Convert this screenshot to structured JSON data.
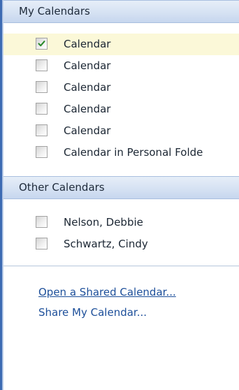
{
  "my_calendars": {
    "header": "My Calendars",
    "items": [
      {
        "label": "Calendar",
        "checked": true
      },
      {
        "label": "Calendar",
        "checked": false
      },
      {
        "label": "Calendar",
        "checked": false
      },
      {
        "label": "Calendar",
        "checked": false
      },
      {
        "label": "Calendar",
        "checked": false
      },
      {
        "label": "Calendar in Personal Folde",
        "checked": false
      }
    ]
  },
  "other_calendars": {
    "header": "Other Calendars",
    "items": [
      {
        "label": "Nelson, Debbie",
        "checked": false
      },
      {
        "label": "Schwartz, Cindy",
        "checked": false
      }
    ]
  },
  "links": {
    "open_shared": "Open a Shared Calendar...",
    "share_my": "Share My Calendar..."
  },
  "colors": {
    "link": "#1d4f9a",
    "selected_row": "#fbf8d8",
    "check_mark": "#2b8a2b",
    "header_gradient_top": "#e6eef8",
    "header_gradient_bottom": "#c6d6ee"
  }
}
